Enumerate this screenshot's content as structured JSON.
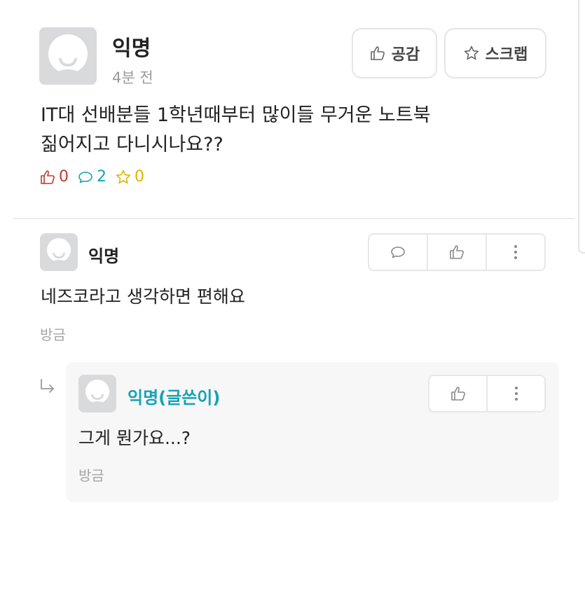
{
  "post": {
    "author": "익명",
    "time": "4분 전",
    "like_button_label": "공감",
    "scrap_button_label": "스크랩",
    "content_line1": "IT대 선배분들 1학년때부터 많이들 무거운 노트북",
    "content_line2": "짊어지고 다니시나요??",
    "like_count": "0",
    "comment_count": "2",
    "scrap_count": "0"
  },
  "comment": {
    "author": "익명",
    "text": "네즈코라고 생각하면 편해요",
    "time": "방금"
  },
  "reply": {
    "author": "익명(글쓴이)",
    "text": "그게 뭔가요...?",
    "time": "방금"
  },
  "colors": {
    "like": "#c0392b",
    "comment": "#15a3b5",
    "scrap": "#e0b400",
    "op_author": "#13a3b5"
  },
  "icons": {
    "post_like": "thumbs-up-icon",
    "post_scrap": "star-icon",
    "comment_reply": "speech-bubble-icon",
    "comment_like": "thumbs-up-icon",
    "comment_more": "more-vertical-icon",
    "reply_arrow": "reply-arrow-icon"
  }
}
